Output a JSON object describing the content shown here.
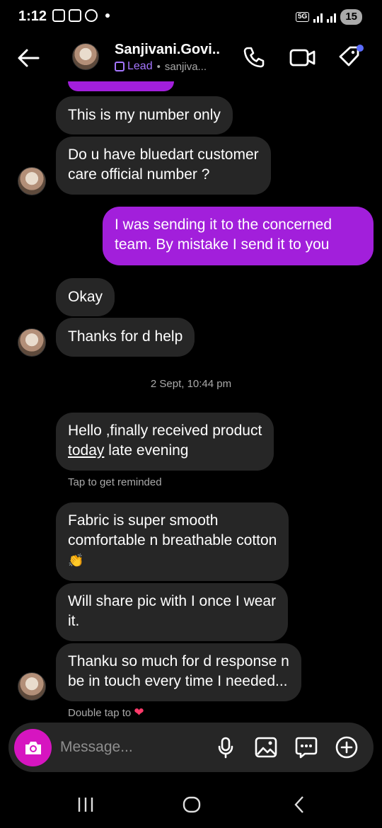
{
  "status": {
    "time": "1:12",
    "network": "5G",
    "battery": "15"
  },
  "header": {
    "name": "Sanjivani.Govi...",
    "label": "Lead",
    "separator": "•",
    "handle": "sanjiva..."
  },
  "messages": [
    {
      "text": "This is my number only"
    },
    {
      "line1": "Do u have bluedart customer",
      "line2": "care official number ?"
    },
    {
      "line1": "I was sending it to the concerned",
      "line2": "team. By mistake I send it to you"
    },
    {
      "text": "Okay"
    },
    {
      "text": "Thanks for d help"
    },
    {
      "line1": "Hello ,finally received product",
      "underlined": "today",
      "rest": " late evening"
    },
    {
      "line1": "Fabric is super smooth",
      "line2": "comfortable n breathable cotton",
      "emoji": "👏"
    },
    {
      "line1": "Will share pic with I once I wear",
      "line2": "it."
    },
    {
      "line1": "Thanku so much for d response n",
      "line2": "be in touch every time I needed..."
    }
  ],
  "timestamp": "2 Sept, 10:44 pm",
  "hints": {
    "remind": "Tap to get reminded",
    "double_tap": "Double tap to",
    "heart": "❤"
  },
  "composer": {
    "placeholder": "Message..."
  },
  "colors": {
    "background": "#000000",
    "incoming_bubble": "#262626",
    "outgoing_bubble": "#a21fdb",
    "accent_purple": "#a576ff",
    "camera_button": "#d615c0",
    "notification_dot": "#5b6cff"
  }
}
